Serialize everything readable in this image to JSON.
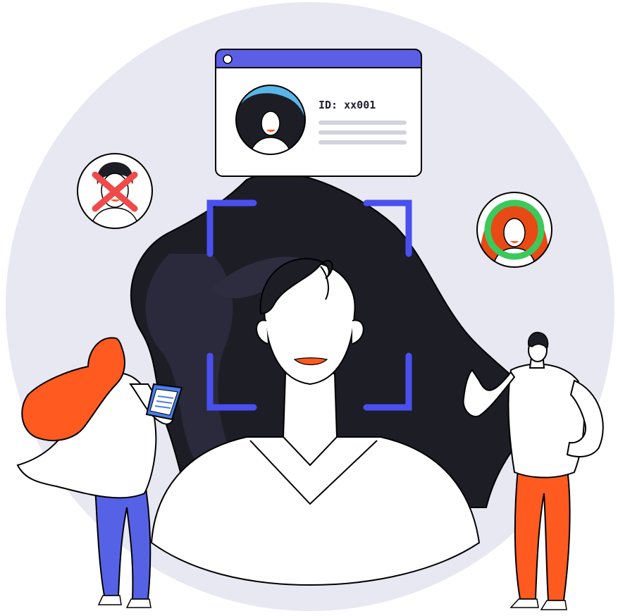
{
  "id_card": {
    "id_text": "ID: xx001"
  },
  "colors": {
    "background_circle": "#e8e8f2",
    "hair_dark": "#1d1d26",
    "hair_shadow": "#2a2a3c",
    "scan_frame": "#4a4ff0",
    "card_header": "#5b5fe6",
    "reject_mark": "#f04a4a",
    "approve_ring": "#3cc95c",
    "accent_orange": "#ff5a1f",
    "pants_blue": "#5662e6",
    "skin_white": "#ffffff"
  },
  "icons": {
    "rejected_face": "x-mark-icon",
    "approved_face": "check-ring-icon",
    "scan_frame": "face-scan-frame-icon"
  }
}
